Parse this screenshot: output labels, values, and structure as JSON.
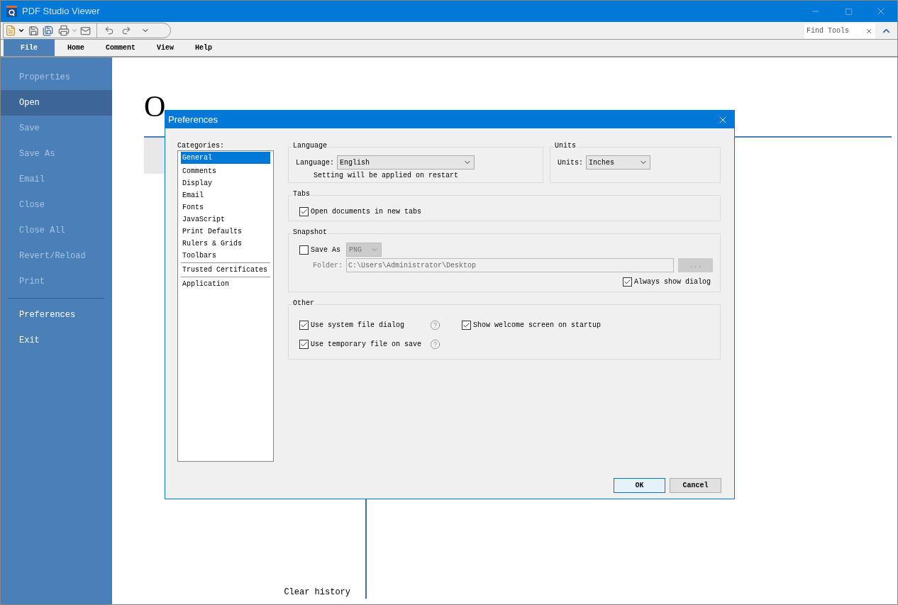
{
  "window": {
    "title": "PDF Studio Viewer"
  },
  "find_tools": {
    "placeholder": "Find Tools"
  },
  "menu_tabs": [
    {
      "label": "File",
      "selected": true
    },
    {
      "label": "Home",
      "selected": false
    },
    {
      "label": "Comment",
      "selected": false
    },
    {
      "label": "View",
      "selected": false
    },
    {
      "label": "Help",
      "selected": false
    }
  ],
  "sidebar": {
    "items": [
      {
        "label": "Properties",
        "selected": false,
        "disabled": true
      },
      {
        "label": "Open",
        "selected": true,
        "disabled": false
      },
      {
        "label": "Save",
        "selected": false,
        "disabled": true
      },
      {
        "label": "Save As",
        "selected": false,
        "disabled": true
      },
      {
        "label": "Email",
        "selected": false,
        "disabled": true
      },
      {
        "label": "Close",
        "selected": false,
        "disabled": true
      },
      {
        "label": "Close All",
        "selected": false,
        "disabled": true
      },
      {
        "label": "Revert/Reload",
        "selected": false,
        "disabled": true
      },
      {
        "label": "Print",
        "selected": false,
        "disabled": true
      },
      {
        "kind": "divider"
      },
      {
        "label": "Preferences",
        "selected": false,
        "disabled": false
      },
      {
        "label": "Exit",
        "selected": false,
        "disabled": false
      }
    ]
  },
  "main": {
    "heading": "O",
    "clear_history": "Clear history"
  },
  "dialog": {
    "title": "Preferences",
    "categories_label": "Categories:",
    "category_groups": [
      {
        "items": [
          {
            "label": "General",
            "selected": true
          },
          {
            "label": "Comments",
            "selected": false
          },
          {
            "label": "Display",
            "selected": false
          },
          {
            "label": "Email",
            "selected": false
          },
          {
            "label": "Fonts",
            "selected": false
          },
          {
            "label": "JavaScript",
            "selected": false
          },
          {
            "label": "Print Defaults",
            "selected": false
          },
          {
            "label": "Rulers & Grids",
            "selected": false
          },
          {
            "label": "Toolbars",
            "selected": false
          }
        ]
      },
      {
        "items": [
          {
            "label": "Trusted Certificates",
            "selected": false
          }
        ]
      },
      {
        "items": [
          {
            "label": "Application",
            "selected": false
          }
        ]
      }
    ],
    "language": {
      "title": "Language",
      "label": "Language:",
      "value": "English",
      "note": "Setting will be applied on restart"
    },
    "units": {
      "title": "Units",
      "label": "Units:",
      "value": "Inches"
    },
    "tabs": {
      "title": "Tabs",
      "option": {
        "label": "Open documents in new tabs",
        "checked": true
      }
    },
    "snapshot": {
      "title": "Snapshot",
      "save_as": {
        "label": "Save As",
        "checked": false
      },
      "format": {
        "value": "PNG",
        "disabled": true
      },
      "folder": {
        "label": "Folder:",
        "value": "C:\\Users\\Administrator\\Desktop",
        "disabled": true
      },
      "browse": {
        "label": "...",
        "disabled": true
      },
      "always_show": {
        "label": "Always show dialog",
        "checked": true
      }
    },
    "other": {
      "title": "Other",
      "options": [
        {
          "label": "Use system file dialog",
          "checked": true,
          "help": true
        },
        {
          "label": "Show welcome screen on startup",
          "checked": true,
          "help": false
        },
        {
          "label": "Use temporary file on save",
          "checked": true,
          "help": true
        }
      ]
    },
    "buttons": [
      {
        "label": "OK",
        "default": true
      },
      {
        "label": "Cancel",
        "default": false
      }
    ]
  }
}
